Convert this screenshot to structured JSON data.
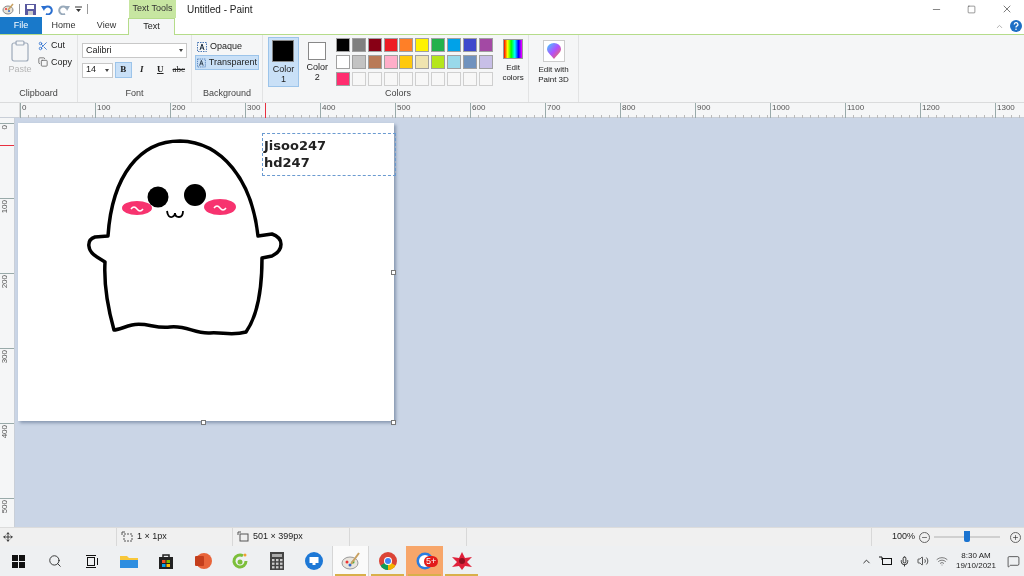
{
  "title_bar": {
    "contextual_group": "Text Tools",
    "title": "Untitled - Paint"
  },
  "tabs": [
    {
      "label": "File",
      "kind": "file",
      "selected": false
    },
    {
      "label": "Home",
      "kind": "tab",
      "selected": false
    },
    {
      "label": "View",
      "kind": "tab",
      "selected": false
    },
    {
      "label": "Text",
      "kind": "tab",
      "selected": true
    }
  ],
  "ribbon": {
    "clipboard": {
      "paste": {
        "label": "Paste",
        "disabled": true
      },
      "cut": "Cut",
      "copy": "Copy",
      "label": "Clipboard"
    },
    "font": {
      "family": "Calibri",
      "size": "14",
      "styles": [
        {
          "label": "B",
          "kind": "bold",
          "selected": true
        },
        {
          "label": "I",
          "kind": "italic",
          "selected": false
        },
        {
          "label": "U",
          "kind": "underline",
          "selected": false
        },
        {
          "label": "abc",
          "kind": "strike",
          "selected": false
        }
      ],
      "label": "Font"
    },
    "background": {
      "options": [
        {
          "label": "Opaque",
          "selected": false
        },
        {
          "label": "Transparent",
          "selected": true
        }
      ],
      "label": "Background"
    },
    "colors": {
      "slots": [
        {
          "label": "Color 1",
          "color": "#000000",
          "selected": true
        },
        {
          "label": "Color 2",
          "color": "#ffffff",
          "selected": false
        }
      ],
      "palette": [
        {
          "kind": "swatch",
          "color": "#000000"
        },
        {
          "kind": "swatch",
          "color": "#7f7f7f"
        },
        {
          "kind": "swatch",
          "color": "#880015"
        },
        {
          "kind": "swatch",
          "color": "#ed1c24"
        },
        {
          "kind": "swatch",
          "color": "#ff7f27"
        },
        {
          "kind": "swatch",
          "color": "#fff200"
        },
        {
          "kind": "swatch",
          "color": "#22b14c"
        },
        {
          "kind": "swatch",
          "color": "#00a2e8"
        },
        {
          "kind": "swatch",
          "color": "#3f48cc"
        },
        {
          "kind": "swatch",
          "color": "#a349a4"
        },
        {
          "kind": "swatch",
          "color": "#ffffff"
        },
        {
          "kind": "swatch",
          "color": "#c3c3c3"
        },
        {
          "kind": "swatch",
          "color": "#b97a57"
        },
        {
          "kind": "swatch",
          "color": "#ffaec9"
        },
        {
          "kind": "swatch",
          "color": "#ffc90e"
        },
        {
          "kind": "swatch",
          "color": "#efe4b0"
        },
        {
          "kind": "swatch",
          "color": "#b5e61d"
        },
        {
          "kind": "swatch",
          "color": "#99d9ea"
        },
        {
          "kind": "swatch",
          "color": "#7092be"
        },
        {
          "kind": "swatch",
          "color": "#c8bfe7"
        },
        {
          "kind": "swatch",
          "color": "#ff2d6f"
        },
        {
          "kind": "empty"
        },
        {
          "kind": "empty"
        },
        {
          "kind": "empty"
        },
        {
          "kind": "empty"
        },
        {
          "kind": "empty"
        },
        {
          "kind": "empty"
        },
        {
          "kind": "empty"
        },
        {
          "kind": "empty"
        },
        {
          "kind": "empty"
        }
      ],
      "edit": "Edit colors",
      "label": "Colors"
    },
    "paint3d": "Edit with Paint 3D"
  },
  "rulers": {
    "horizontal": [
      "0",
      "100",
      "200",
      "300",
      "400",
      "500",
      "600",
      "700",
      "800",
      "900",
      "1000",
      "1100",
      "1200",
      "1300"
    ],
    "vertical": [
      "0",
      "100",
      "200",
      "300",
      "400",
      "500"
    ]
  },
  "canvas": {
    "text_lines": [
      "Jisoo247",
      "hd247"
    ]
  },
  "status_bar": {
    "selection": "1 × 1px",
    "size": "501 × 399px",
    "zoom": "100%",
    "zoom_slider": {
      "level": 0.5
    }
  },
  "taskbar": {
    "apps": [
      {
        "kind": "explorer",
        "selected": false,
        "running": false,
        "attention": false
      },
      {
        "kind": "store",
        "selected": false,
        "running": false,
        "attention": false
      },
      {
        "kind": "presentation",
        "selected": false,
        "running": false,
        "attention": false
      },
      {
        "kind": "camera",
        "selected": false,
        "running": false,
        "attention": false
      },
      {
        "kind": "calculator",
        "selected": false,
        "running": false,
        "attention": false
      },
      {
        "kind": "remote",
        "selected": false,
        "running": false,
        "attention": false
      },
      {
        "kind": "paint",
        "selected": true,
        "running": true,
        "attention": false
      },
      {
        "kind": "browser",
        "selected": false,
        "running": true,
        "attention": false
      },
      {
        "kind": "chat",
        "selected": false,
        "running": true,
        "attention": true,
        "badge": "5+"
      },
      {
        "kind": "star",
        "selected": false,
        "running": true,
        "attention": false
      }
    ],
    "time": "8:30 AM",
    "date": "19/10/2021"
  }
}
